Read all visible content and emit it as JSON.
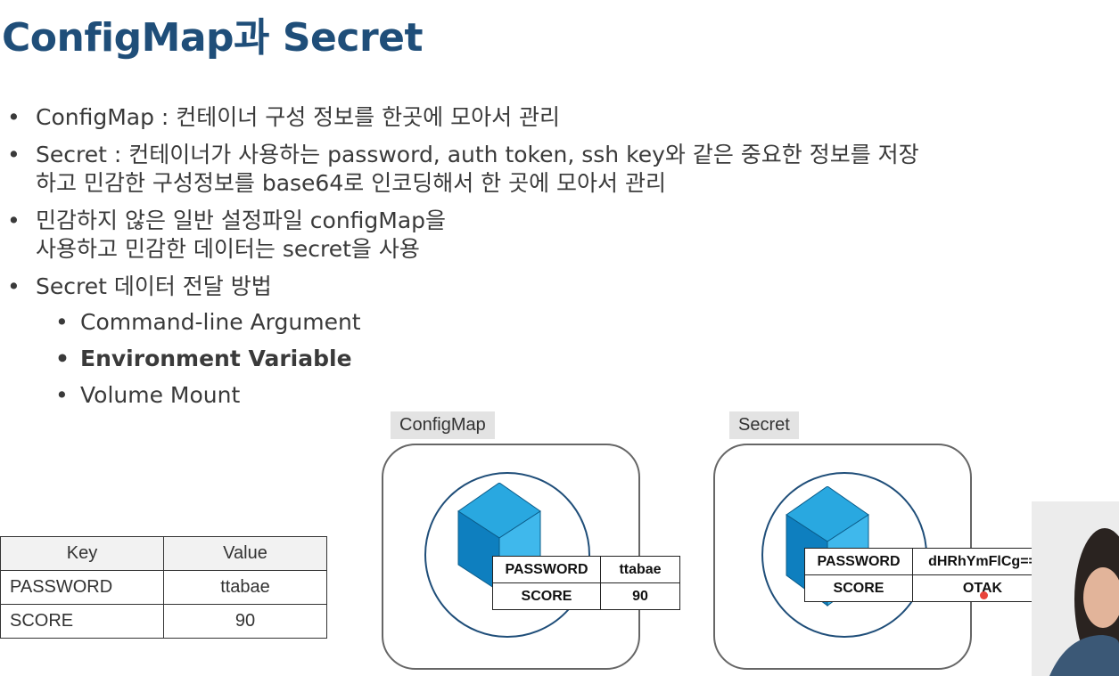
{
  "title": "ConfigMap과 Secret",
  "bullets": [
    "ConfigMap : 컨테이너 구성 정보를 한곳에 모아서 관리",
    "Secret : 컨테이너가 사용하는 password, auth token, ssh key와 같은 중요한 정보를 저장",
    "하고 민감한 구성정보를 base64로 인코딩해서 한 곳에 모아서 관리",
    "민감하지 않은 일반 설정파일 configMap을",
    "사용하고 민감한 데이터는 secret을 사용",
    "Secret 데이터 전달 방법"
  ],
  "sub_bullets": [
    "Command-line Argument",
    "Environment Variable",
    "Volume Mount"
  ],
  "kv_table": {
    "headers": [
      "Key",
      "Value"
    ],
    "rows": [
      [
        "PASSWORD",
        "ttabae"
      ],
      [
        "SCORE",
        "90"
      ]
    ]
  },
  "configmap_panel": {
    "label": "ConfigMap",
    "rows": [
      [
        "PASSWORD",
        "ttabae"
      ],
      [
        "SCORE",
        "90"
      ]
    ]
  },
  "secret_panel": {
    "label": "Secret",
    "rows": [
      [
        "PASSWORD",
        "dHRhYmFlCg=="
      ],
      [
        "SCORE",
        "OTAK"
      ]
    ]
  },
  "colors": {
    "title": "#1f4e79",
    "cube_top": "#29a8e0",
    "cube_side": "#0e7fbf",
    "circle": "#1f4e79"
  }
}
